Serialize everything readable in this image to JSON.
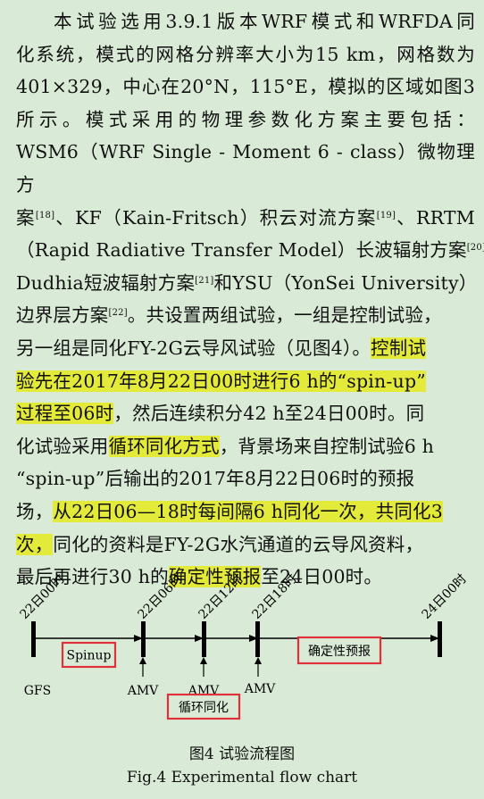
{
  "paragraph": {
    "l1": "本试验选用3.9.1版本WRF模式和WRFDA同",
    "l2": "化系统，模式的网格分辨率大小为15 km，网格数为",
    "l3": "401×329，中心在20°N，115°E，模拟的区域如图3",
    "l4": "所示。模式采用的物理参数化方案主要包括：",
    "l5": "WSM6（WRF Single - Moment 6 - class）微物理方",
    "l6a": "案",
    "ref18": "[18]",
    "l6b": "、KF（Kain-Fritsch）积云对流方案",
    "ref19": "[19]",
    "l6c": "、RRTM",
    "l7a": "（Rapid Radiative Transfer Model）长波辐射方案",
    "ref20": "[20]",
    "l7b": "、",
    "l8a": "Dudhia短波辐射方案",
    "ref21": "[21]",
    "l8b": "和YSU（YonSei University）",
    "l9a": "边界层方案",
    "ref22": "[22]",
    "l9b": "。共设置两组试验，一组是控制试验，",
    "l10a": "另一组是同化FY-2G云导风试验（见图4）。",
    "l10b": "控制试",
    "l11a": "验先在2017年8月22日00时进行6 h的“spin-up”",
    "l12a": "过程至06时",
    "l12b": "，然后连续积分42 h至24日00时。同",
    "l13a": "化试验采用",
    "l13b": "循环同化方式",
    "l13c": "，背景场来自控制试验6 h",
    "l14": "“spin-up”后输出的2017年8月22日06时的预报",
    "l15a": "场，",
    "l15b": "从22日06—18时每间隔6 h同化一次，共同化3",
    "l16a": "次，",
    "l16b": "同化的资料是FY-2G水汽通道的云导风资料，",
    "l17a": "最后再进行30 h的",
    "l17b": "确定性预报",
    "l17c": "至24日00时。"
  },
  "diagram": {
    "times": [
      "22日00时",
      "22日06时",
      "22日12时",
      "22日18时",
      "24日00时"
    ],
    "gfs": "GFS",
    "amv": [
      "AMV",
      "AMV",
      "AMV"
    ],
    "spinup": "Spinup",
    "cycle": "循环同化",
    "forecast": "确定性预报",
    "box_color": "#e0303a"
  },
  "caption": {
    "cn": "图4   试验流程图",
    "en": "Fig.4   Experimental flow chart"
  }
}
